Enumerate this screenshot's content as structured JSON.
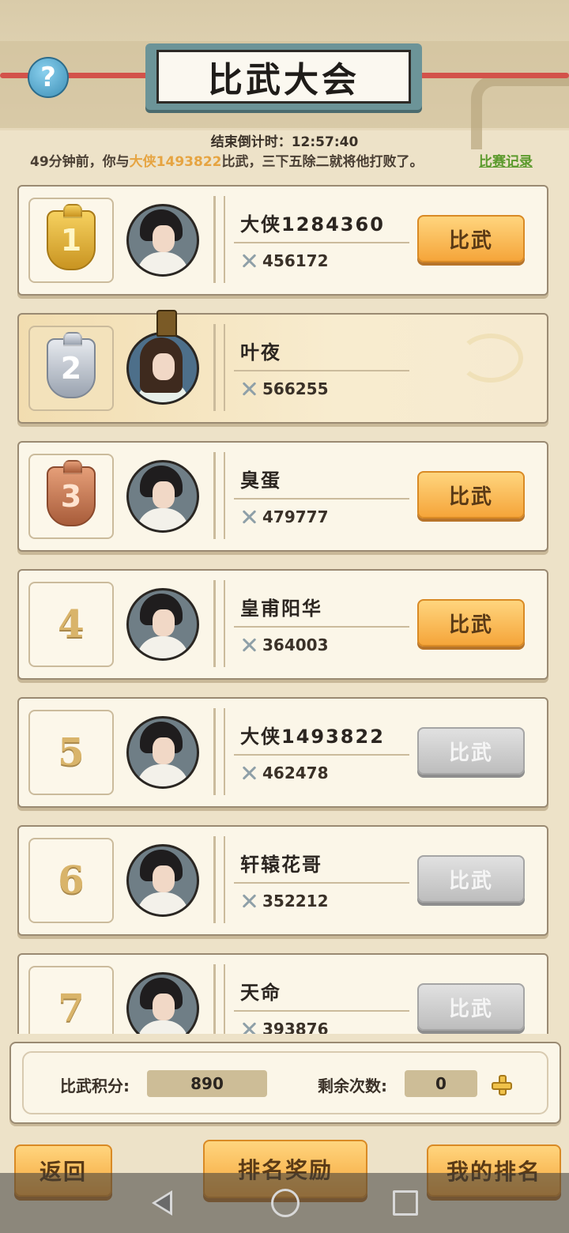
{
  "header": {
    "title": "比武大会",
    "help_icon": "?"
  },
  "countdown": {
    "label": "结束倒计时：12:57:40"
  },
  "news": {
    "prefix": "49分钟前，你与",
    "opponent": "大侠1493822",
    "suffix": "比武，三下五除二就将他打败了。",
    "record_link": "比赛记录"
  },
  "ranking": [
    {
      "rank": "1",
      "name": "大侠1284360",
      "power": "456172",
      "button": "比武",
      "button_state": "active",
      "medal": "gold"
    },
    {
      "rank": "2",
      "name": "叶夜",
      "power": "566255",
      "button": "",
      "button_state": "self",
      "medal": "silver"
    },
    {
      "rank": "3",
      "name": "臭蛋",
      "power": "479777",
      "button": "比武",
      "button_state": "active",
      "medal": "bronze"
    },
    {
      "rank": "4",
      "name": "皇甫阳华",
      "power": "364003",
      "button": "比武",
      "button_state": "active",
      "medal": "none"
    },
    {
      "rank": "5",
      "name": "大侠1493822",
      "power": "462478",
      "button": "比武",
      "button_state": "disabled",
      "medal": "none"
    },
    {
      "rank": "6",
      "name": "轩辕花哥",
      "power": "352212",
      "button": "比武",
      "button_state": "disabled",
      "medal": "none"
    },
    {
      "rank": "7",
      "name": "天命",
      "power": "393876",
      "button": "比武",
      "button_state": "disabled",
      "medal": "none"
    }
  ],
  "stats": {
    "points_label": "比武积分:",
    "points_value": "890",
    "remaining_label": "剩余次数:",
    "remaining_value": "0"
  },
  "footer": {
    "back": "返回",
    "rewards": "排名奖励",
    "my_rank": "我的排名"
  },
  "colors": {
    "button_active": "#f5a53a",
    "button_disabled": "#bdbdbd",
    "highlight_name": "#e6a441",
    "record_link": "#5b9a2c"
  }
}
